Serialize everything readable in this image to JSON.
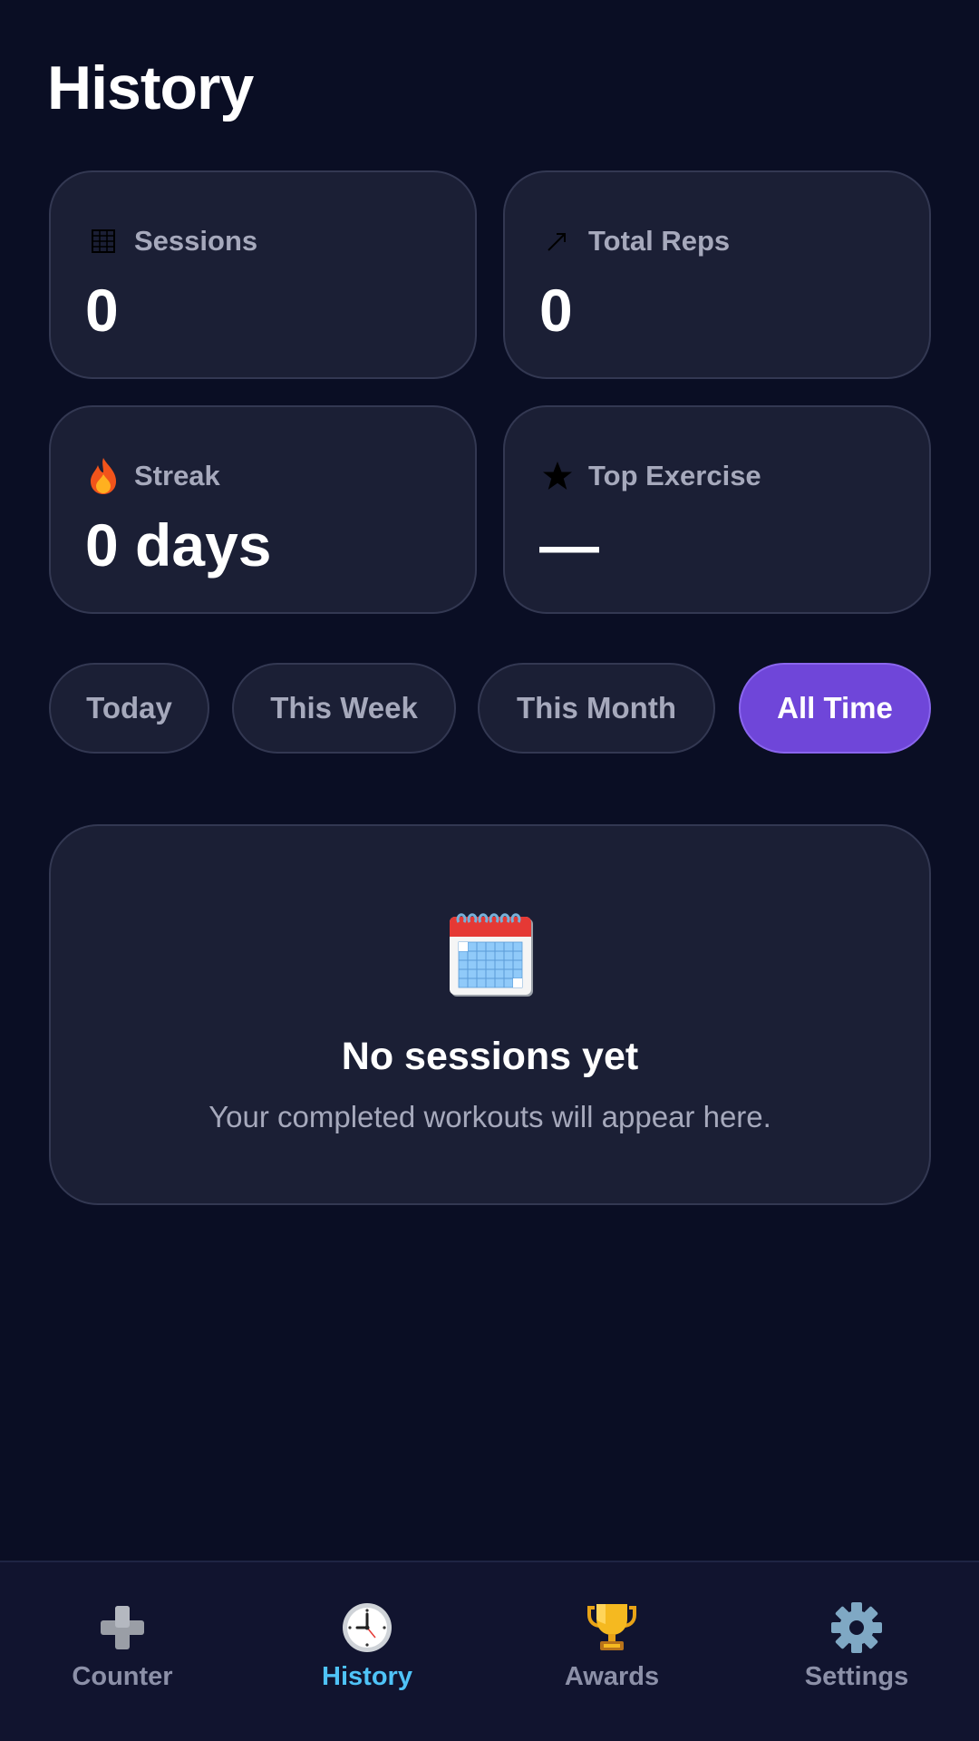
{
  "page": {
    "title": "History"
  },
  "stats": [
    {
      "label": "Sessions",
      "value": "0",
      "icon": "calendar-grid-icon"
    },
    {
      "label": "Total Reps",
      "value": "0",
      "icon": "trend-arrow-icon"
    },
    {
      "label": "Streak",
      "value": "0 days",
      "icon": "fire-icon"
    },
    {
      "label": "Top Exercise",
      "value": "—",
      "icon": "star-icon"
    }
  ],
  "filters": {
    "options": [
      "Today",
      "This Week",
      "This Month",
      "All Time"
    ],
    "selected": "All Time"
  },
  "empty_state": {
    "icon": "spiral-calendar-icon",
    "title": "No sessions yet",
    "subtitle": "Your completed workouts will appear here."
  },
  "nav": {
    "items": [
      {
        "label": "Counter",
        "icon": "plus-icon"
      },
      {
        "label": "History",
        "icon": "clock-icon"
      },
      {
        "label": "Awards",
        "icon": "trophy-icon"
      },
      {
        "label": "Settings",
        "icon": "gear-icon"
      }
    ],
    "active": "History"
  },
  "colors": {
    "background": "#0a0e24",
    "card": "#1b1f35",
    "accent": "#6f46d9",
    "active_nav": "#4fc3f7"
  }
}
